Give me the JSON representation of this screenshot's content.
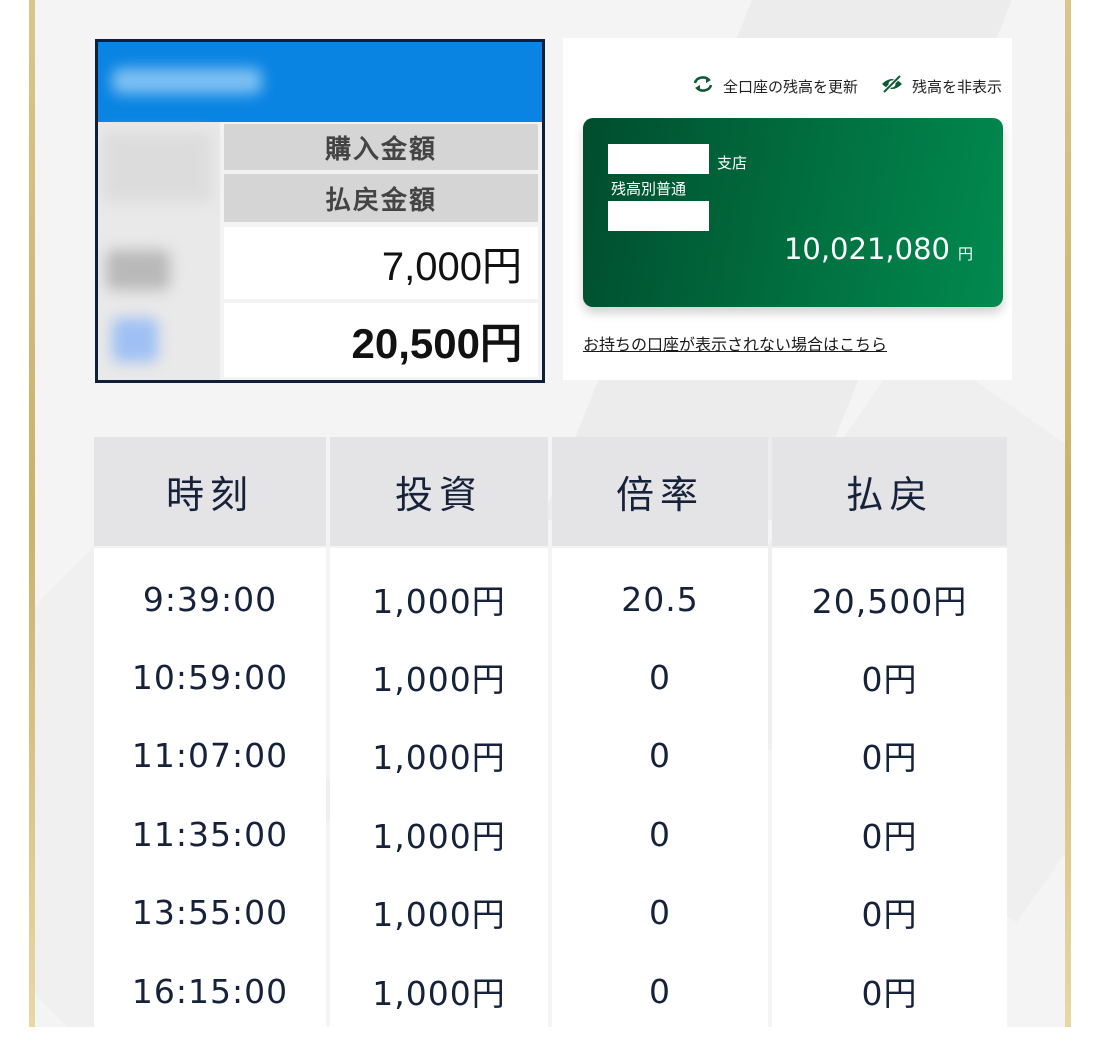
{
  "snapshot": {
    "purchase_label": "購入金額",
    "payout_label": "払戻金額",
    "purchase_value": "7,000円",
    "payout_value": "20,500円"
  },
  "account_panel": {
    "refresh_label": "全口座の残高を更新",
    "hide_label": "残高を非表示",
    "branch_suffix": "支店",
    "account_type": "残高別普通",
    "balance": "10,021,080",
    "currency": "円",
    "missing_account_link": "お持ちの口座が表示されない場合はこちら",
    "card_gradient": [
      "#004d2e",
      "#018a50"
    ]
  },
  "table": {
    "headers": [
      "時刻",
      "投資",
      "倍率",
      "払戻"
    ],
    "rows": [
      [
        "9:39:00",
        "1,000円",
        "20.5",
        "20,500円"
      ],
      [
        "10:59:00",
        "1,000円",
        "0",
        "0円"
      ],
      [
        "11:07:00",
        "1,000円",
        "0",
        "0円"
      ],
      [
        "11:35:00",
        "1,000円",
        "0",
        "0円"
      ],
      [
        "13:55:00",
        "1,000円",
        "0",
        "0円"
      ],
      [
        "16:15:00",
        "1,000円",
        "0",
        "0円"
      ]
    ]
  },
  "colors": {
    "snapshot_bar": "#0a84e3",
    "table_header_bg": "#e4e4e6",
    "text_navy": "#16213a",
    "gold_border": "#c9b26a"
  }
}
